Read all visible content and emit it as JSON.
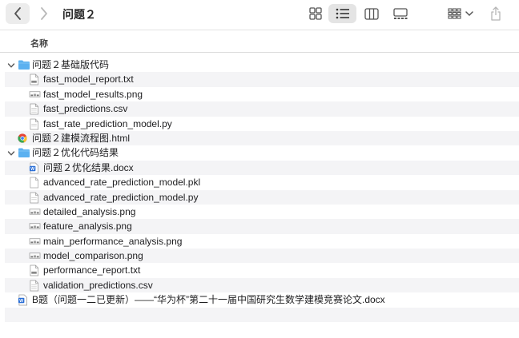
{
  "window": {
    "title": "问题２"
  },
  "header": {
    "name_column": "名称"
  },
  "files": [
    {
      "name": "问题２基础版代码",
      "kind": "folder",
      "level": 0,
      "icon": "folder-icon"
    },
    {
      "name": "fast_model_report.txt",
      "kind": "txt",
      "level": 1,
      "icon": "text-file-icon"
    },
    {
      "name": "fast_model_results.png",
      "kind": "png",
      "level": 1,
      "icon": "image-file-icon"
    },
    {
      "name": "fast_predictions.csv",
      "kind": "csv",
      "level": 1,
      "icon": "document-file-icon"
    },
    {
      "name": "fast_rate_prediction_model.py",
      "kind": "py",
      "level": 1,
      "icon": "document-file-icon"
    },
    {
      "name": "问题２建模流程图.html",
      "kind": "html",
      "level": 0,
      "icon": "chrome-html-icon"
    },
    {
      "name": "问题２优化代码结果",
      "kind": "folder",
      "level": 0,
      "icon": "folder-icon"
    },
    {
      "name": "问题２优化结果.docx",
      "kind": "docx",
      "level": 1,
      "icon": "word-document-icon"
    },
    {
      "name": "advanced_rate_prediction_model.pkl",
      "kind": "pkl",
      "level": 1,
      "icon": "blank-file-icon"
    },
    {
      "name": "advanced_rate_prediction_model.py",
      "kind": "py",
      "level": 1,
      "icon": "document-file-icon"
    },
    {
      "name": "detailed_analysis.png",
      "kind": "png",
      "level": 1,
      "icon": "image-file-icon"
    },
    {
      "name": "feature_analysis.png",
      "kind": "png",
      "level": 1,
      "icon": "image-file-icon"
    },
    {
      "name": "main_performance_analysis.png",
      "kind": "png",
      "level": 1,
      "icon": "image-file-icon"
    },
    {
      "name": "model_comparison.png",
      "kind": "png",
      "level": 1,
      "icon": "image-file-icon"
    },
    {
      "name": "performance_report.txt",
      "kind": "txt",
      "level": 1,
      "icon": "text-file-icon"
    },
    {
      "name": "validation_predictions.csv",
      "kind": "csv",
      "level": 1,
      "icon": "document-file-icon"
    },
    {
      "name": "B题（问题一二已更新）——“华为杯”第二十一届中国研究生数学建模竞赛论文.docx",
      "kind": "docx",
      "level": 0,
      "icon": "word-document-icon"
    }
  ],
  "colors": {
    "folder": "#5bb1f0",
    "word": "#2b6fd6",
    "selection": "#e4e4e4",
    "stripe": "#f4f4f6"
  }
}
